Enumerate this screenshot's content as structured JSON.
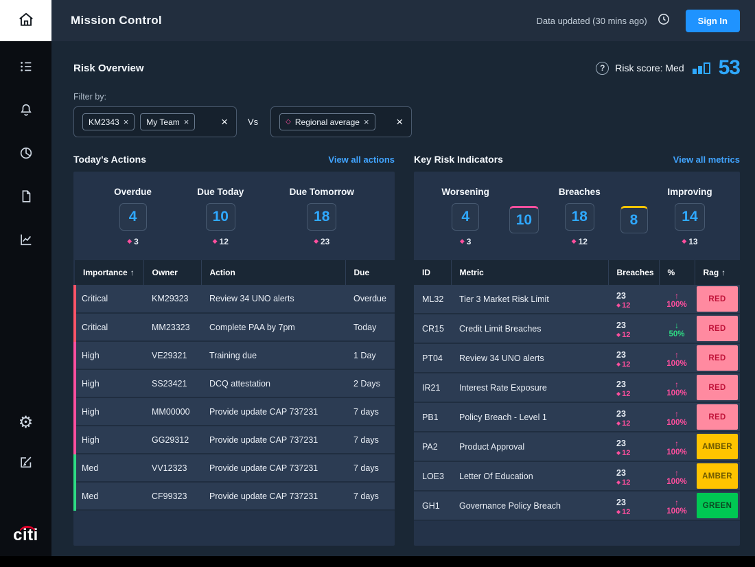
{
  "colors": {
    "accent_blue": "#2fa8ff",
    "link_blue": "#41a4ff",
    "pink": "#ff4f9e",
    "critical_red": "#ff5468",
    "green": "#2edb84",
    "amber": "#ffc400",
    "badge_red_bg": "#ff8aa0",
    "badge_green_bg": "#00c853",
    "citi_red": "#e4002b"
  },
  "sidebar": {
    "logo": "citi",
    "icons": [
      "home-icon",
      "list-icon",
      "bell-icon",
      "pie-chart-icon",
      "document-icon",
      "line-chart-icon",
      "gear-icon",
      "compose-icon"
    ]
  },
  "header": {
    "title": "Mission Control",
    "data_updated": "Data updated (30 mins ago)",
    "sign_in_label": "Sign In"
  },
  "risk_overview": {
    "title": "Risk Overview",
    "help_glyph": "?",
    "score_label": "Risk score: Med",
    "score_value": "53"
  },
  "filters": {
    "label": "Filter by:",
    "vs": "Vs",
    "group1": {
      "chips": [
        "KM2343",
        "My Team"
      ]
    },
    "group2": {
      "chips": [
        "Regional average"
      ]
    }
  },
  "todays_actions": {
    "title": "Today's Actions",
    "view_all": "View all actions",
    "stats": [
      {
        "label": "Overdue",
        "value": "4",
        "delta": "3"
      },
      {
        "label": "Due Today",
        "value": "10",
        "delta": "12"
      },
      {
        "label": "Due Tomorrow",
        "value": "18",
        "delta": "23"
      }
    ],
    "table": {
      "columns": [
        "Importance",
        "Owner",
        "Action",
        "Due"
      ],
      "rows": [
        {
          "importance": "Critical",
          "severity": "critical",
          "owner": "KM29323",
          "action": "Review 34 UNO alerts",
          "due": "Overdue"
        },
        {
          "importance": "Critical",
          "severity": "critical",
          "owner": "MM23323",
          "action": "Complete PAA by 7pm",
          "due": "Today"
        },
        {
          "importance": "High",
          "severity": "high",
          "owner": "VE29321",
          "action": "Training due",
          "due": "1 Day"
        },
        {
          "importance": "High",
          "severity": "high",
          "owner": "SS23421",
          "action": "DCQ attestation",
          "due": "2 Days"
        },
        {
          "importance": "High",
          "severity": "high",
          "owner": "MM00000",
          "action": "Provide update CAP 737231",
          "due": "7 days"
        },
        {
          "importance": "High",
          "severity": "high",
          "owner": "GG29312",
          "action": "Provide update CAP 737231",
          "due": "7 days"
        },
        {
          "importance": "Med",
          "severity": "med",
          "owner": "VV12323",
          "action": "Provide update CAP 737231",
          "due": "7 days"
        },
        {
          "importance": "Med",
          "severity": "med",
          "owner": "CF99323",
          "action": "Provide update CAP 737231",
          "due": "7 days"
        }
      ]
    }
  },
  "key_risk_indicators": {
    "title": "Key Risk Indicators",
    "view_all": "View all metrics",
    "stats": {
      "worsening": {
        "label": "Worsening",
        "value": "4",
        "delta": "3"
      },
      "breaches": {
        "label": "Breaches",
        "boxes": [
          {
            "value": "10",
            "accent": "pink"
          },
          {
            "value": "18",
            "accent": "none"
          },
          {
            "value": "8",
            "accent": "yellow"
          }
        ],
        "delta": "12"
      },
      "improving": {
        "label": "Improving",
        "value": "14",
        "delta": "13"
      }
    },
    "table": {
      "columns": [
        "ID",
        "Metric",
        "Breaches",
        "%",
        "Rag"
      ],
      "rows": [
        {
          "id": "ML32",
          "metric": "Tier 3 Market Risk Limit",
          "breaches": "23",
          "delta": "12",
          "pct": "100%",
          "trend": "up",
          "rag": "RED"
        },
        {
          "id": "CR15",
          "metric": "Credit Limit Breaches",
          "breaches": "23",
          "delta": "12",
          "pct": "50%",
          "trend": "down",
          "rag": "RED"
        },
        {
          "id": "PT04",
          "metric": "Review 34 UNO alerts",
          "breaches": "23",
          "delta": "12",
          "pct": "100%",
          "trend": "up",
          "rag": "RED"
        },
        {
          "id": "IR21",
          "metric": "Interest Rate Exposure",
          "breaches": "23",
          "delta": "12",
          "pct": "100%",
          "trend": "up",
          "rag": "RED"
        },
        {
          "id": "PB1",
          "metric": "Policy Breach - Level 1",
          "breaches": "23",
          "delta": "12",
          "pct": "100%",
          "trend": "up",
          "rag": "RED"
        },
        {
          "id": "PA2",
          "metric": "Product Approval",
          "breaches": "23",
          "delta": "12",
          "pct": "100%",
          "trend": "up",
          "rag": "AMBER"
        },
        {
          "id": "LOE3",
          "metric": "Letter Of Education",
          "breaches": "23",
          "delta": "12",
          "pct": "100%",
          "trend": "up",
          "rag": "AMBER"
        },
        {
          "id": "GH1",
          "metric": "Governance Policy Breach",
          "breaches": "23",
          "delta": "12",
          "pct": "100%",
          "trend": "up",
          "rag": "GREEN"
        }
      ]
    }
  }
}
